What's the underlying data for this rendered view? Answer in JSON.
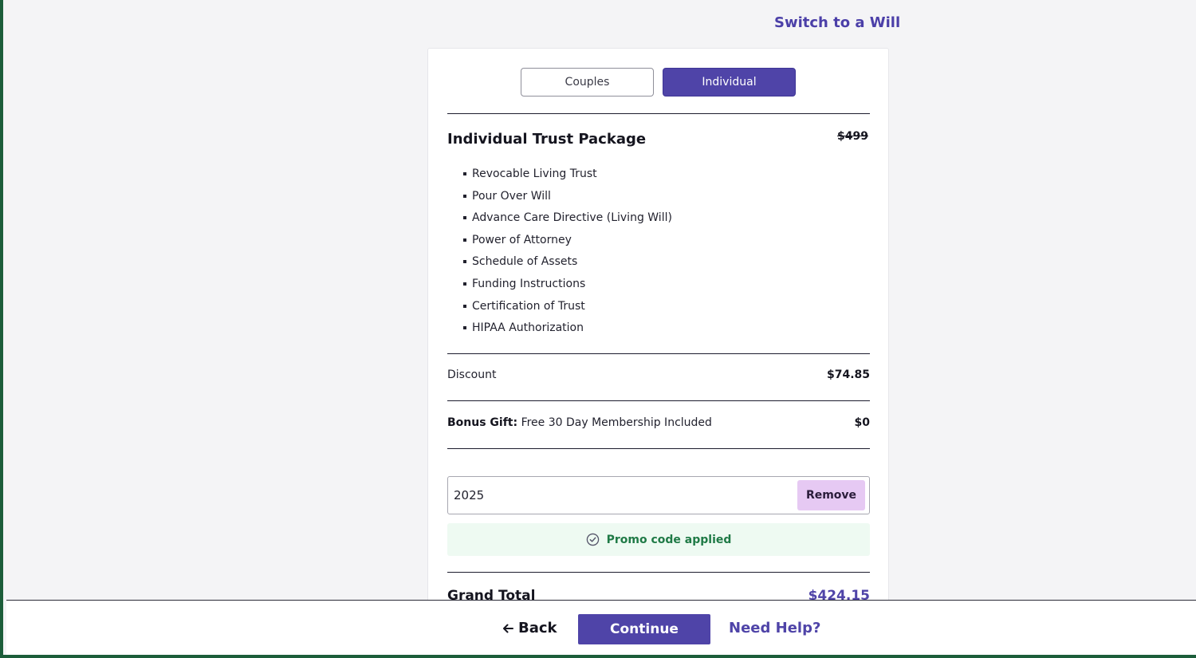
{
  "header": {
    "switch_link": "Switch to a Will"
  },
  "plan_toggle": {
    "couples_label": "Couples",
    "individual_label": "Individual",
    "selected": "Individual"
  },
  "package": {
    "title": "Individual Trust Package",
    "original_price": "$499",
    "features": [
      "Revocable Living Trust",
      "Pour Over Will",
      "Advance Care Directive (Living Will)",
      "Power of Attorney",
      "Schedule of Assets",
      "Funding Instructions",
      "Certification of Trust",
      "HIPAA Authorization"
    ]
  },
  "discount": {
    "label": "Discount",
    "amount": "$74.85"
  },
  "bonus": {
    "label_bold": "Bonus Gift:",
    "label_rest": "Free 30 Day Membership Included",
    "amount": "$0"
  },
  "promo": {
    "value": "2025",
    "remove_label": "Remove",
    "status_text": "Promo code applied"
  },
  "grand_total": {
    "label": "Grand Total",
    "amount": "$424.15"
  },
  "footer": {
    "back_label": "Back",
    "continue_label": "Continue",
    "help_label": "Need Help?"
  },
  "colors": {
    "accent": "#4f44a8",
    "remove_button_bg": "#e6c9f3",
    "success_text": "#1f7a46",
    "success_bg": "#eefaf2",
    "frame_border": "#1c5d3a"
  }
}
